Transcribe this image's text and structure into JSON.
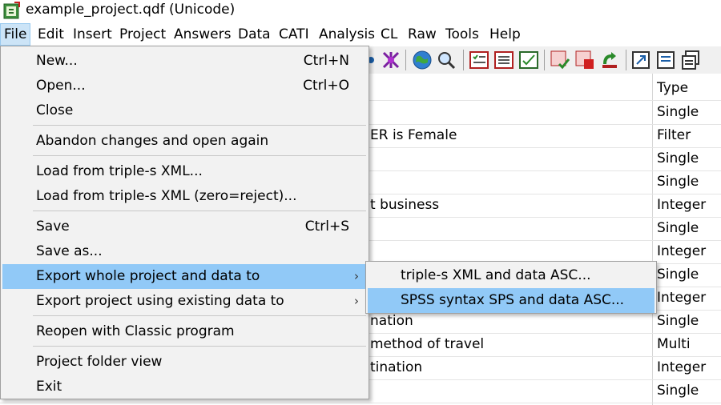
{
  "window": {
    "title": "example_project.qdf (Unicode)"
  },
  "menubar": {
    "items": [
      "File",
      "Edit",
      "Insert",
      "Project",
      "Answers",
      "Data",
      "CATI",
      "Analysis",
      "CL",
      "Raw",
      "Tools",
      "Help"
    ],
    "active": "File"
  },
  "toolbar": {
    "icons": [
      "butterfly-icon",
      "flower-icon",
      "globe-icon",
      "magnifier-icon",
      "checklist-icon",
      "list-icon",
      "edit-list-icon",
      "check-grid-icon",
      "red-grid-icon",
      "recycle-icon",
      "export-icon",
      "document-icon",
      "copy-stack-icon"
    ]
  },
  "grid": {
    "type_header": "Type",
    "rows": [
      {
        "text": "",
        "type": "Single"
      },
      {
        "text": "ER is Female",
        "type": "Filter"
      },
      {
        "text": "",
        "type": "Single"
      },
      {
        "text": "",
        "type": "Single"
      },
      {
        "text": "t business",
        "type": "Integer"
      },
      {
        "text": "",
        "type": "Single"
      },
      {
        "text": "",
        "type": "Integer"
      },
      {
        "text": "",
        "type": "Single"
      },
      {
        "text": "",
        "type": "Integer"
      },
      {
        "text": "nation",
        "type": "Single"
      },
      {
        "text": "method of travel",
        "type": "Multi"
      },
      {
        "text": "tination",
        "type": "Integer"
      },
      {
        "text": "",
        "type": "Single"
      }
    ]
  },
  "file_menu": {
    "items": [
      {
        "label": "New...",
        "shortcut": "Ctrl+N"
      },
      {
        "label": "Open...",
        "shortcut": "Ctrl+O"
      },
      {
        "label": "Close",
        "shortcut": ""
      },
      {
        "label": "Abandon changes and open again",
        "shortcut": ""
      },
      {
        "label": "Load from triple-s XML...",
        "shortcut": ""
      },
      {
        "label": "Load from triple-s XML (zero=reject)...",
        "shortcut": ""
      },
      {
        "label": "Save",
        "shortcut": "Ctrl+S"
      },
      {
        "label": "Save as...",
        "shortcut": ""
      },
      {
        "label": "Export whole project and data to",
        "shortcut": "",
        "submenu": true
      },
      {
        "label": "Export project using existing data to",
        "shortcut": "",
        "submenu": true
      },
      {
        "label": "Reopen with Classic program",
        "shortcut": ""
      },
      {
        "label": "Project folder view",
        "shortcut": ""
      },
      {
        "label": "Exit",
        "shortcut": ""
      }
    ]
  },
  "submenu": {
    "items": [
      {
        "label": "triple-s XML and data ASC..."
      },
      {
        "label": "SPSS syntax SPS and data ASC..."
      }
    ]
  },
  "colors": {
    "highlight": "#91c9f7",
    "menu_bg": "#f2f2f2",
    "active_menu_bg": "#cce4f7"
  }
}
